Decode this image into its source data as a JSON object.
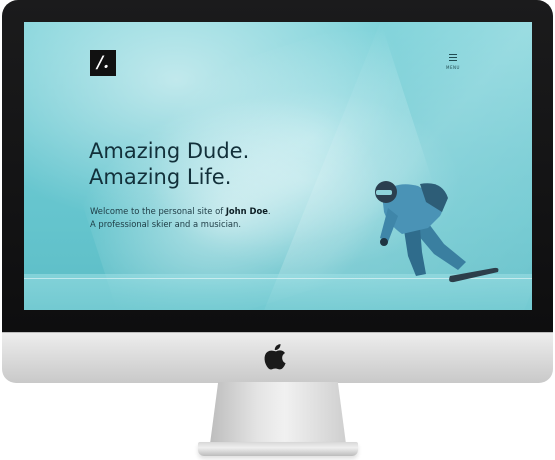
{
  "site": {
    "logo_text": "/.",
    "menu_label": "MENU",
    "hero": {
      "title_line1": "Amazing Dude.",
      "title_line2": "Amazing Life.",
      "intro_prefix": "Welcome to the personal site of ",
      "intro_name": "John Doe",
      "intro_suffix": ".",
      "intro_line2": "A professional skier and a musician."
    }
  },
  "icons": {
    "logo": "brand-logo",
    "menu": "hamburger-menu-icon",
    "device_logo": "apple-logo-icon"
  },
  "colors": {
    "screen_bg": "#6bc8d1",
    "text_dark": "#12303a",
    "logo_bg": "#111111",
    "bezel": "#141415",
    "chin": "#e2e2e2"
  }
}
